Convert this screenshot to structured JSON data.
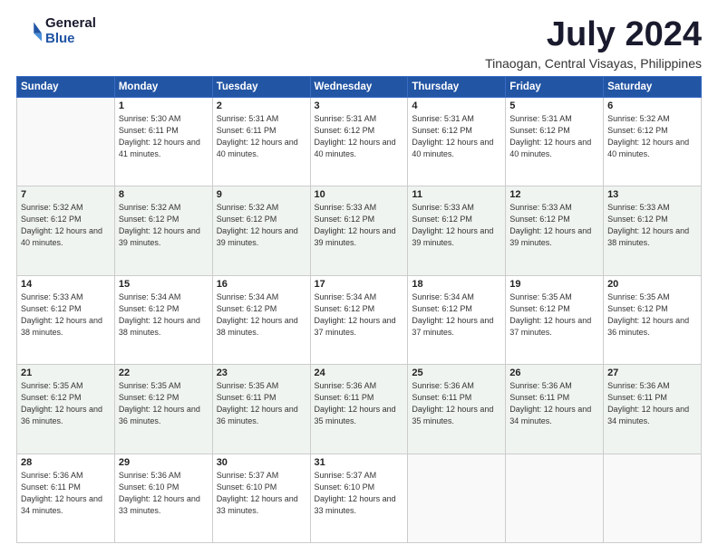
{
  "logo": {
    "general": "General",
    "blue": "Blue"
  },
  "title": "July 2024",
  "location": "Tinaogan, Central Visayas, Philippines",
  "days_header": [
    "Sunday",
    "Monday",
    "Tuesday",
    "Wednesday",
    "Thursday",
    "Friday",
    "Saturday"
  ],
  "weeks": [
    [
      {
        "day": "",
        "sunrise": "",
        "sunset": "",
        "daylight": ""
      },
      {
        "day": "1",
        "sunrise": "Sunrise: 5:30 AM",
        "sunset": "Sunset: 6:11 PM",
        "daylight": "Daylight: 12 hours and 41 minutes."
      },
      {
        "day": "2",
        "sunrise": "Sunrise: 5:31 AM",
        "sunset": "Sunset: 6:11 PM",
        "daylight": "Daylight: 12 hours and 40 minutes."
      },
      {
        "day": "3",
        "sunrise": "Sunrise: 5:31 AM",
        "sunset": "Sunset: 6:12 PM",
        "daylight": "Daylight: 12 hours and 40 minutes."
      },
      {
        "day": "4",
        "sunrise": "Sunrise: 5:31 AM",
        "sunset": "Sunset: 6:12 PM",
        "daylight": "Daylight: 12 hours and 40 minutes."
      },
      {
        "day": "5",
        "sunrise": "Sunrise: 5:31 AM",
        "sunset": "Sunset: 6:12 PM",
        "daylight": "Daylight: 12 hours and 40 minutes."
      },
      {
        "day": "6",
        "sunrise": "Sunrise: 5:32 AM",
        "sunset": "Sunset: 6:12 PM",
        "daylight": "Daylight: 12 hours and 40 minutes."
      }
    ],
    [
      {
        "day": "7",
        "sunrise": "Sunrise: 5:32 AM",
        "sunset": "Sunset: 6:12 PM",
        "daylight": "Daylight: 12 hours and 40 minutes."
      },
      {
        "day": "8",
        "sunrise": "Sunrise: 5:32 AM",
        "sunset": "Sunset: 6:12 PM",
        "daylight": "Daylight: 12 hours and 39 minutes."
      },
      {
        "day": "9",
        "sunrise": "Sunrise: 5:32 AM",
        "sunset": "Sunset: 6:12 PM",
        "daylight": "Daylight: 12 hours and 39 minutes."
      },
      {
        "day": "10",
        "sunrise": "Sunrise: 5:33 AM",
        "sunset": "Sunset: 6:12 PM",
        "daylight": "Daylight: 12 hours and 39 minutes."
      },
      {
        "day": "11",
        "sunrise": "Sunrise: 5:33 AM",
        "sunset": "Sunset: 6:12 PM",
        "daylight": "Daylight: 12 hours and 39 minutes."
      },
      {
        "day": "12",
        "sunrise": "Sunrise: 5:33 AM",
        "sunset": "Sunset: 6:12 PM",
        "daylight": "Daylight: 12 hours and 39 minutes."
      },
      {
        "day": "13",
        "sunrise": "Sunrise: 5:33 AM",
        "sunset": "Sunset: 6:12 PM",
        "daylight": "Daylight: 12 hours and 38 minutes."
      }
    ],
    [
      {
        "day": "14",
        "sunrise": "Sunrise: 5:33 AM",
        "sunset": "Sunset: 6:12 PM",
        "daylight": "Daylight: 12 hours and 38 minutes."
      },
      {
        "day": "15",
        "sunrise": "Sunrise: 5:34 AM",
        "sunset": "Sunset: 6:12 PM",
        "daylight": "Daylight: 12 hours and 38 minutes."
      },
      {
        "day": "16",
        "sunrise": "Sunrise: 5:34 AM",
        "sunset": "Sunset: 6:12 PM",
        "daylight": "Daylight: 12 hours and 38 minutes."
      },
      {
        "day": "17",
        "sunrise": "Sunrise: 5:34 AM",
        "sunset": "Sunset: 6:12 PM",
        "daylight": "Daylight: 12 hours and 37 minutes."
      },
      {
        "day": "18",
        "sunrise": "Sunrise: 5:34 AM",
        "sunset": "Sunset: 6:12 PM",
        "daylight": "Daylight: 12 hours and 37 minutes."
      },
      {
        "day": "19",
        "sunrise": "Sunrise: 5:35 AM",
        "sunset": "Sunset: 6:12 PM",
        "daylight": "Daylight: 12 hours and 37 minutes."
      },
      {
        "day": "20",
        "sunrise": "Sunrise: 5:35 AM",
        "sunset": "Sunset: 6:12 PM",
        "daylight": "Daylight: 12 hours and 36 minutes."
      }
    ],
    [
      {
        "day": "21",
        "sunrise": "Sunrise: 5:35 AM",
        "sunset": "Sunset: 6:12 PM",
        "daylight": "Daylight: 12 hours and 36 minutes."
      },
      {
        "day": "22",
        "sunrise": "Sunrise: 5:35 AM",
        "sunset": "Sunset: 6:12 PM",
        "daylight": "Daylight: 12 hours and 36 minutes."
      },
      {
        "day": "23",
        "sunrise": "Sunrise: 5:35 AM",
        "sunset": "Sunset: 6:11 PM",
        "daylight": "Daylight: 12 hours and 36 minutes."
      },
      {
        "day": "24",
        "sunrise": "Sunrise: 5:36 AM",
        "sunset": "Sunset: 6:11 PM",
        "daylight": "Daylight: 12 hours and 35 minutes."
      },
      {
        "day": "25",
        "sunrise": "Sunrise: 5:36 AM",
        "sunset": "Sunset: 6:11 PM",
        "daylight": "Daylight: 12 hours and 35 minutes."
      },
      {
        "day": "26",
        "sunrise": "Sunrise: 5:36 AM",
        "sunset": "Sunset: 6:11 PM",
        "daylight": "Daylight: 12 hours and 34 minutes."
      },
      {
        "day": "27",
        "sunrise": "Sunrise: 5:36 AM",
        "sunset": "Sunset: 6:11 PM",
        "daylight": "Daylight: 12 hours and 34 minutes."
      }
    ],
    [
      {
        "day": "28",
        "sunrise": "Sunrise: 5:36 AM",
        "sunset": "Sunset: 6:11 PM",
        "daylight": "Daylight: 12 hours and 34 minutes."
      },
      {
        "day": "29",
        "sunrise": "Sunrise: 5:36 AM",
        "sunset": "Sunset: 6:10 PM",
        "daylight": "Daylight: 12 hours and 33 minutes."
      },
      {
        "day": "30",
        "sunrise": "Sunrise: 5:37 AM",
        "sunset": "Sunset: 6:10 PM",
        "daylight": "Daylight: 12 hours and 33 minutes."
      },
      {
        "day": "31",
        "sunrise": "Sunrise: 5:37 AM",
        "sunset": "Sunset: 6:10 PM",
        "daylight": "Daylight: 12 hours and 33 minutes."
      },
      {
        "day": "",
        "sunrise": "",
        "sunset": "",
        "daylight": ""
      },
      {
        "day": "",
        "sunrise": "",
        "sunset": "",
        "daylight": ""
      },
      {
        "day": "",
        "sunrise": "",
        "sunset": "",
        "daylight": ""
      }
    ]
  ],
  "colors": {
    "header_bg": "#2255a4",
    "header_text": "#ffffff",
    "border": "#cccccc",
    "row_shade": "#f0f4f0"
  }
}
